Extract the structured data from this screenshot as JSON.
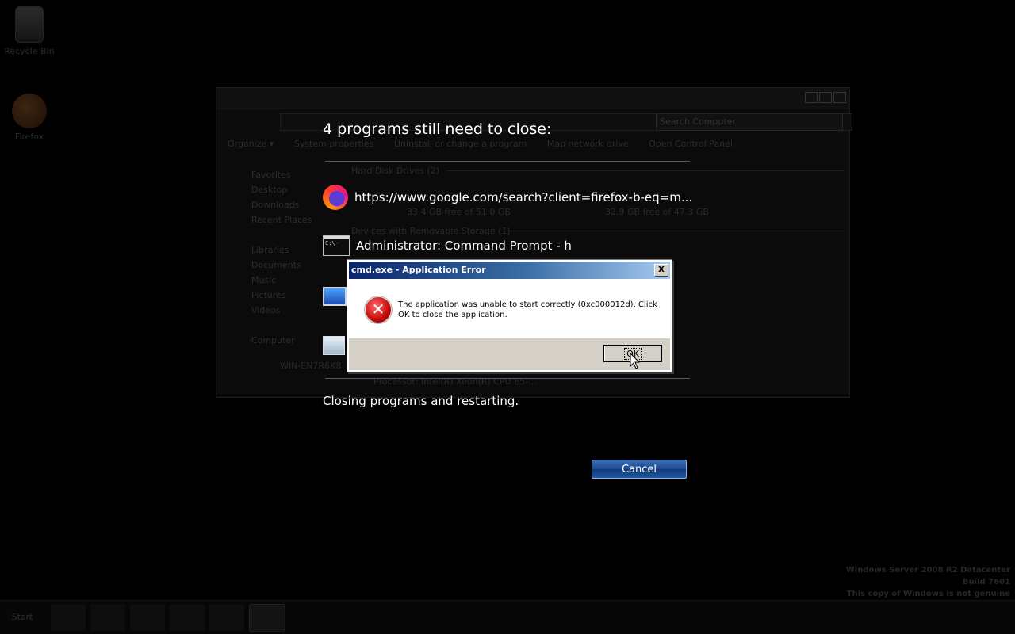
{
  "desktop": {
    "recycle_label": "Recycle Bin",
    "firefox_label": "Firefox"
  },
  "explorer": {
    "search_placeholder": "Search Computer",
    "toolbar": [
      "Organize ▾",
      "System properties",
      "Uninstall or change a program",
      "Map network drive",
      "Open Control Panel"
    ],
    "nav": [
      "Favorites",
      "Desktop",
      "Downloads",
      "Recent Places",
      "",
      "Libraries",
      "Documents",
      "Music",
      "Pictures",
      "Videos",
      "",
      "Computer"
    ],
    "group_hdd": "Hard Disk Drives (2)",
    "hdd1_free": "33.4 GB free of 51.0 GB",
    "hdd2_free": "32.9 GB free of 47.3 GB",
    "group_removable": "Devices with Removable Storage (1)",
    "computer_name": "WIN-EN7R6K8",
    "processor": "Processor: Intel(R) Xeon(R) CPU E5-..."
  },
  "overlay": {
    "title": "4 programs still need to close:",
    "programs": [
      {
        "icon": "firefox-icon",
        "label": "https://www.google.com/search?client=firefox-b-eq=m..."
      },
      {
        "icon": "cmd-icon",
        "label": "Administrator: Command Prompt - h"
      },
      {
        "icon": "computer-icon",
        "label": ""
      },
      {
        "icon": "monitor-icon",
        "label": ""
      }
    ],
    "closing_text": "Closing programs and restarting.",
    "cancel_label": "Cancel"
  },
  "dialog": {
    "title": "cmd.exe - Application Error",
    "close_label": "X",
    "message": "The application was unable to start correctly (0xc000012d). Click OK to close the application.",
    "ok_label": "OK"
  },
  "watermark": {
    "line1": "Windows Server 2008 R2 Datacenter",
    "line2": "Build 7601",
    "line3": "This copy of Windows is not genuine"
  },
  "taskbar": {
    "start_label": "Start"
  }
}
